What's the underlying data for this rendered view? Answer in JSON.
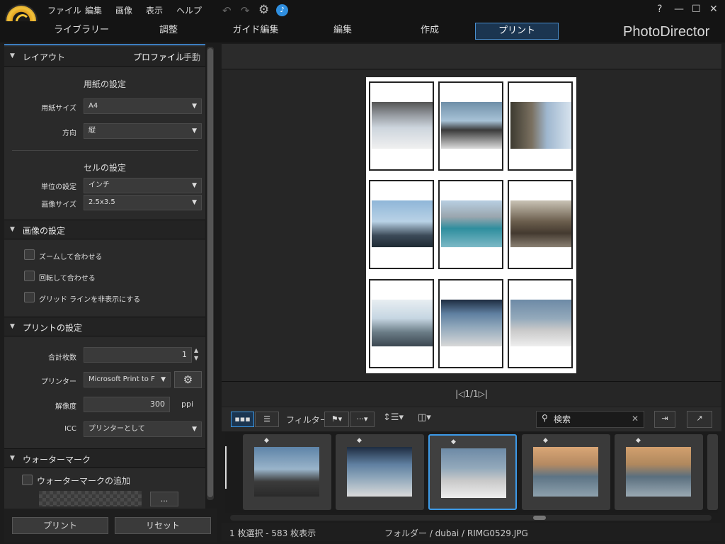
{
  "menu": [
    "ファイル",
    "編集",
    "画像",
    "表示",
    "ヘルプ"
  ],
  "window_controls": [
    "?",
    "—",
    "☐",
    "✕"
  ],
  "tabs": [
    {
      "label": "ライブラリー"
    },
    {
      "label": "調整"
    },
    {
      "label": "ガイド編集"
    },
    {
      "label": "編集"
    },
    {
      "label": "作成"
    },
    {
      "label": "プリント"
    }
  ],
  "active_tab": "プリント",
  "brand": "PhotoDirector",
  "layout": {
    "title": "レイアウト",
    "mode_profile": "プロファイル",
    "mode_manual": "手動",
    "paper_heading": "用紙の設定",
    "paper_size_label": "用紙サイズ",
    "paper_size_value": "A4",
    "orientation_label": "方向",
    "orientation_value": "縦",
    "cell_heading": "セルの設定",
    "unit_label": "単位の設定",
    "unit_value": "インチ",
    "image_size_label": "画像サイズ",
    "image_size_value": "2.5x3.5"
  },
  "image_settings": {
    "title": "画像の設定",
    "zoom_fit": "ズームして合わせる",
    "rotate_fit": "回転して合わせる",
    "hide_grid": "グリッド ラインを非表示にする"
  },
  "print_settings": {
    "title": "プリントの設定",
    "copies_label": "合計枚数",
    "copies_value": "1",
    "printer_label": "プリンター",
    "printer_value": "Microsoft Print to F",
    "resolution_label": "解像度",
    "resolution_value": "300",
    "resolution_unit": "ppi",
    "icc_label": "ICC",
    "icc_value": "プリンターとして"
  },
  "watermark": {
    "title": "ウォーターマーク",
    "add_label": "ウォーターマークの追加",
    "browse_label": "..."
  },
  "buttons": {
    "print": "プリント",
    "reset": "リセット"
  },
  "pager": "|◁1/1▷|",
  "filmstrip": {
    "filter_label": "フィルター:",
    "search_placeholder": "検索"
  },
  "status": {
    "selection": "1 枚選択 - 583 枚表示",
    "path": "フォルダー / dubai / RIMG0529.JPG"
  },
  "colors": {
    "accent": "#3c9ae8",
    "panel": "#2a2a2a",
    "bg": "#1c1c1c"
  }
}
